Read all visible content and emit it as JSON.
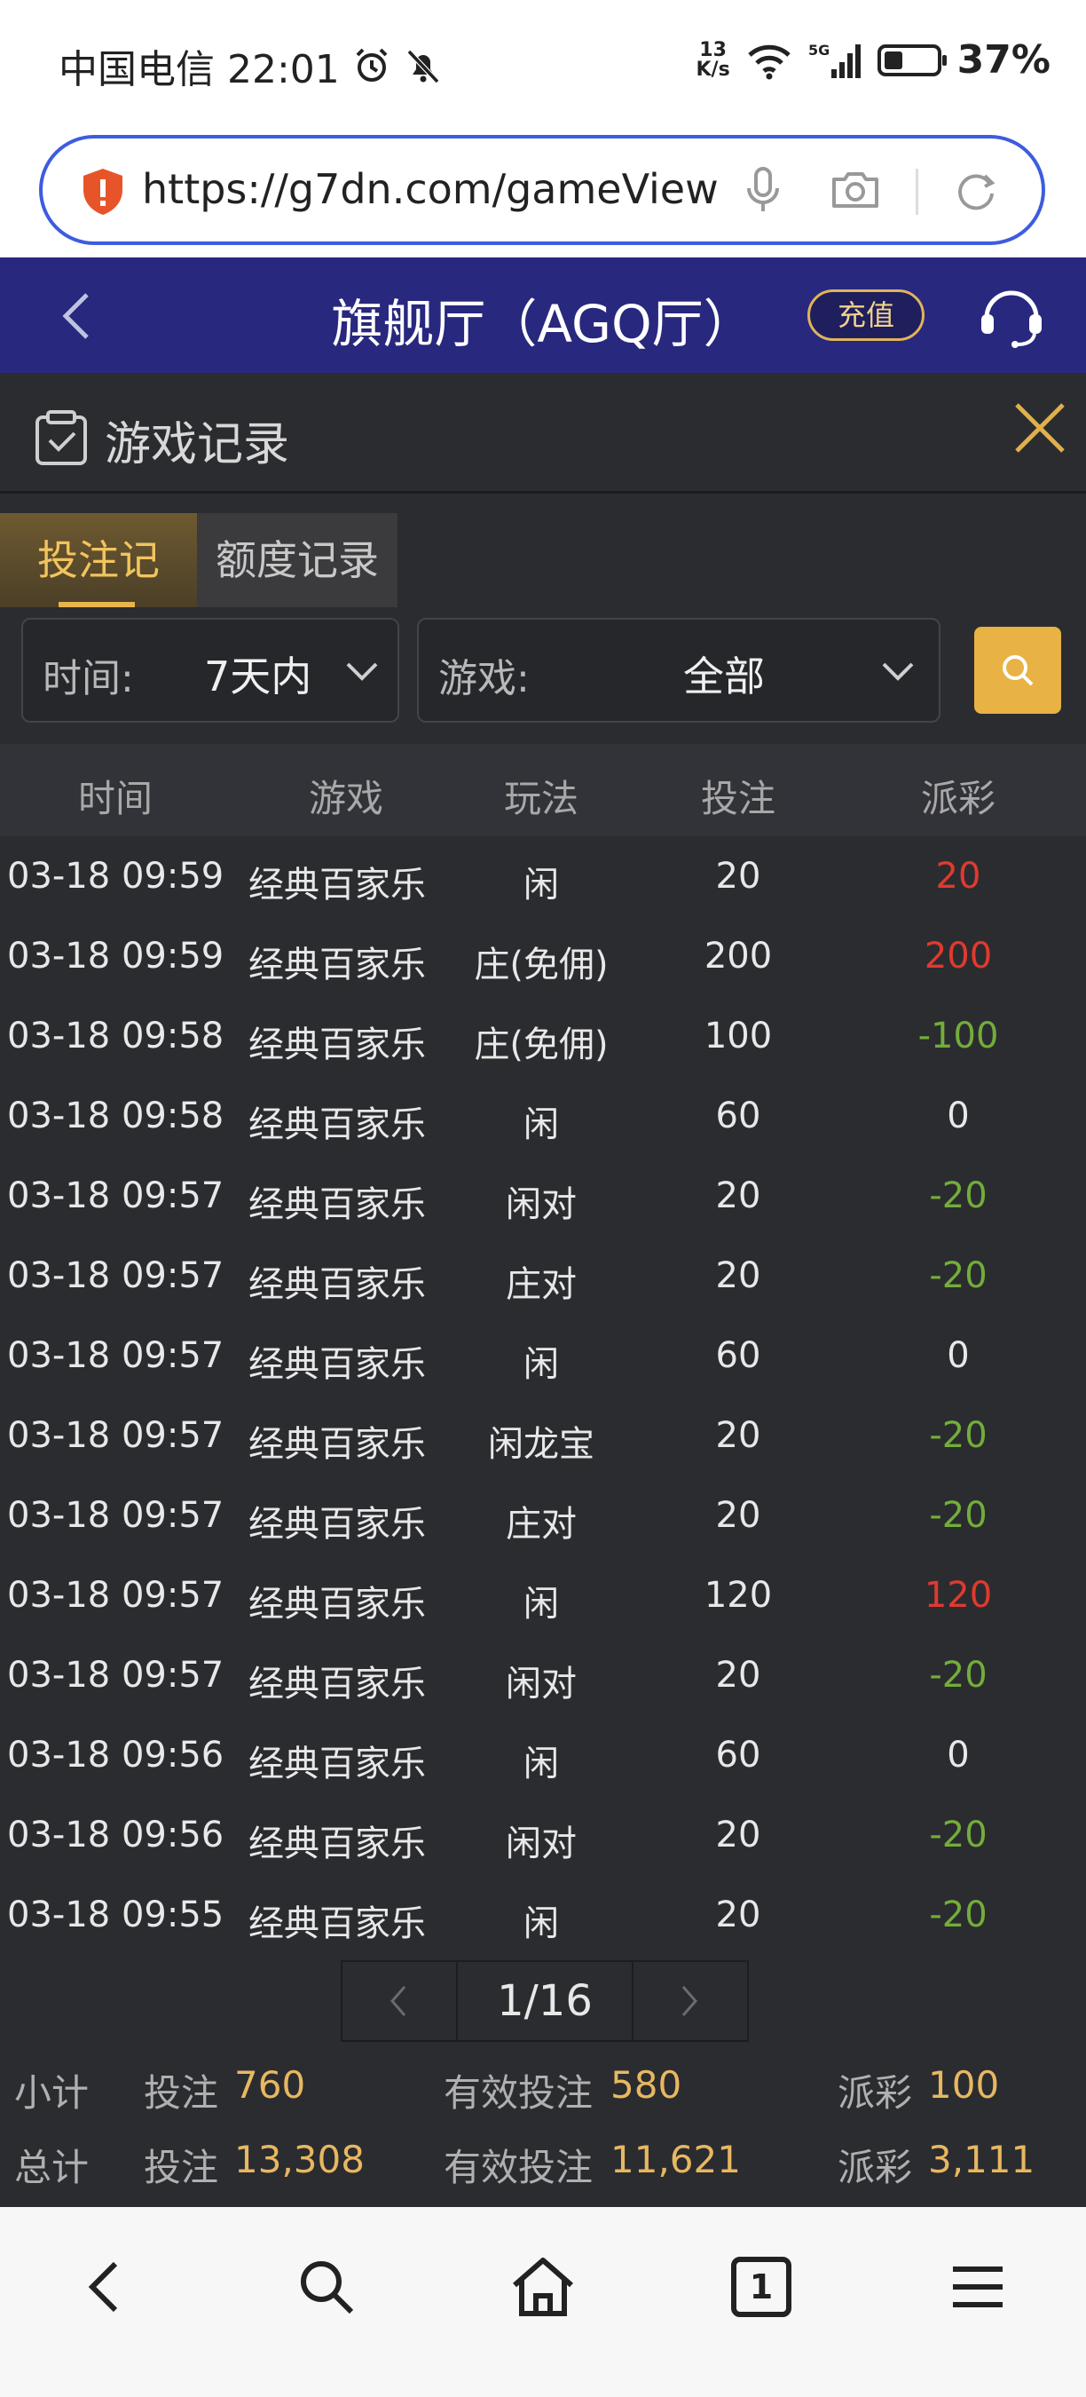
{
  "status_bar": {
    "carrier_time": "中国电信 22:01",
    "net_speed_value": "13",
    "net_speed_unit": "K/s",
    "battery_percent_text": "37%",
    "battery_level": 0.37
  },
  "browser": {
    "url": "https://g7dn.com/gameView"
  },
  "app_header": {
    "title": "旗舰厅（AGQ厅）",
    "recharge_label": "充值"
  },
  "modal": {
    "title": "游戏记录"
  },
  "tabs": [
    {
      "label": "投注记录",
      "active": true
    },
    {
      "label": "额度记录",
      "active": false
    }
  ],
  "filters": {
    "time_label": "时间:",
    "time_value": "7天内",
    "game_label": "游戏:",
    "game_value": "全部"
  },
  "table": {
    "headers": [
      "时间",
      "游戏",
      "玩法",
      "投注",
      "派彩"
    ],
    "rows": [
      {
        "time": "03-18 09:59",
        "game": "经典百家乐",
        "play": "闲",
        "bet": "20",
        "payout": "20"
      },
      {
        "time": "03-18 09:59",
        "game": "经典百家乐",
        "play": "庄(免佣)",
        "bet": "200",
        "payout": "200"
      },
      {
        "time": "03-18 09:58",
        "game": "经典百家乐",
        "play": "庄(免佣)",
        "bet": "100",
        "payout": "-100"
      },
      {
        "time": "03-18 09:58",
        "game": "经典百家乐",
        "play": "闲",
        "bet": "60",
        "payout": "0"
      },
      {
        "time": "03-18 09:57",
        "game": "经典百家乐",
        "play": "闲对",
        "bet": "20",
        "payout": "-20"
      },
      {
        "time": "03-18 09:57",
        "game": "经典百家乐",
        "play": "庄对",
        "bet": "20",
        "payout": "-20"
      },
      {
        "time": "03-18 09:57",
        "game": "经典百家乐",
        "play": "闲",
        "bet": "60",
        "payout": "0"
      },
      {
        "time": "03-18 09:57",
        "game": "经典百家乐",
        "play": "闲龙宝",
        "bet": "20",
        "payout": "-20"
      },
      {
        "time": "03-18 09:57",
        "game": "经典百家乐",
        "play": "庄对",
        "bet": "20",
        "payout": "-20"
      },
      {
        "time": "03-18 09:57",
        "game": "经典百家乐",
        "play": "闲",
        "bet": "120",
        "payout": "120"
      },
      {
        "time": "03-18 09:57",
        "game": "经典百家乐",
        "play": "闲对",
        "bet": "20",
        "payout": "-20"
      },
      {
        "time": "03-18 09:56",
        "game": "经典百家乐",
        "play": "闲",
        "bet": "60",
        "payout": "0"
      },
      {
        "time": "03-18 09:56",
        "game": "经典百家乐",
        "play": "闲对",
        "bet": "20",
        "payout": "-20"
      },
      {
        "time": "03-18 09:55",
        "game": "经典百家乐",
        "play": "闲",
        "bet": "20",
        "payout": "-20"
      }
    ]
  },
  "pagination": {
    "text": "1/16"
  },
  "summary": {
    "subtotal": {
      "label": "小计",
      "bet_label": "投注",
      "bet": "760",
      "valid_label": "有效投注",
      "valid": "580",
      "payout_label": "派彩",
      "payout": "100"
    },
    "total": {
      "label": "总计",
      "bet_label": "投注",
      "bet": "13,308",
      "valid_label": "有效投注",
      "valid": "11,621",
      "payout_label": "派彩",
      "payout": "3,111"
    }
  },
  "colors": {
    "header_bg": "#28287e",
    "panel_bg": "#2b2c30",
    "accent_gold": "#e8b245",
    "win_red": "#e03a2f",
    "loss_green": "#73ad3a",
    "neutral_text": "#e8e8e8"
  },
  "icons": {
    "alarm": "alarm-icon",
    "mute": "bell-off-icon",
    "wifi": "wifi-icon",
    "signal": "signal-icon",
    "security": "shield-icon",
    "mic": "mic-icon",
    "camera": "camera-icon",
    "reload": "reload-icon",
    "back": "chevron-left-icon",
    "support": "headset-icon",
    "record": "clipboard-check-icon",
    "close": "close-icon",
    "search": "search-icon",
    "home": "home-icon",
    "tabs": "tab-count-icon",
    "menu": "menu-icon"
  },
  "bottom_nav": {
    "tab_count": "1"
  }
}
